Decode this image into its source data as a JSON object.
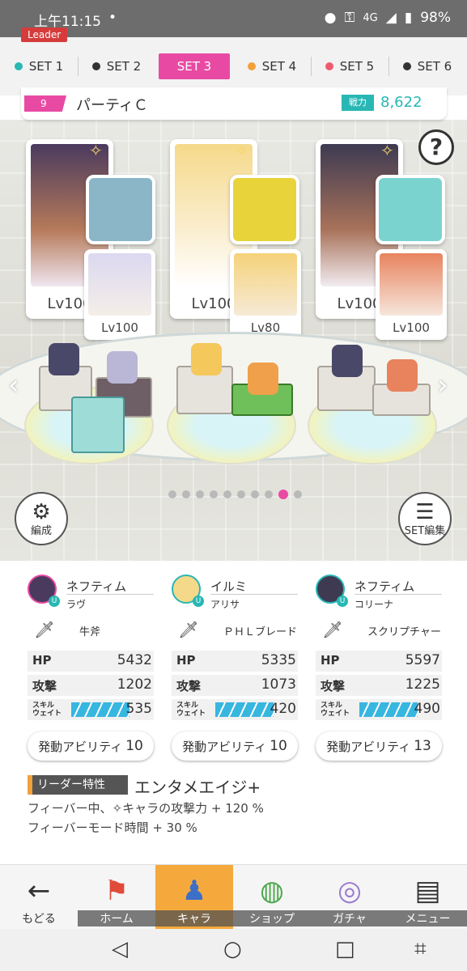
{
  "status": {
    "time": "上午11:15",
    "dot": "•",
    "network": "4G",
    "battery": "98%"
  },
  "tabs": [
    {
      "label": "SET 1",
      "color": "#28b7b4",
      "active": false
    },
    {
      "label": "SET 2",
      "color": "#333333",
      "active": false
    },
    {
      "label": "SET 3",
      "color": "#e84aa3",
      "active": true
    },
    {
      "label": "SET 4",
      "color": "#f2a03c",
      "active": false
    },
    {
      "label": "SET 5",
      "color": "#f05a6e",
      "active": false
    },
    {
      "label": "SET 6",
      "color": "#333333",
      "active": false
    }
  ],
  "party": {
    "number": "9",
    "name": "パーティＣ",
    "power_label": "戦力",
    "power": "8,622"
  },
  "formation": {
    "leader_tag": "Leader",
    "help": "?",
    "members": [
      {
        "main_level": "Lv100",
        "sub_level": "Lv100"
      },
      {
        "main_level": "Lv100",
        "sub_level": "Lv80"
      },
      {
        "main_level": "Lv100",
        "sub_level": "Lv100"
      }
    ],
    "page_dots": 10,
    "page_active": 9,
    "formation_button": "編成",
    "set_edit_button": "SET編集"
  },
  "characters": [
    {
      "name": "ネフティム",
      "sub": "ラヴ",
      "weapon": "牛斧",
      "hp": "5432",
      "atk": "1202",
      "wait": "535",
      "ability_label": "発動アビリティ",
      "ability": "10"
    },
    {
      "name": "イルミ",
      "sub": "アリサ",
      "weapon": "ＰＨＬブレード",
      "hp": "5335",
      "atk": "1073",
      "wait": "420",
      "ability_label": "発動アビリティ",
      "ability": "10"
    },
    {
      "name": "ネフティム",
      "sub": "コリーナ",
      "weapon": "スクリプチャー",
      "hp": "5597",
      "atk": "1225",
      "wait": "490",
      "ability_label": "発動アビリティ",
      "ability": "13"
    }
  ],
  "labels": {
    "hp": "HP",
    "atk": "攻撃",
    "wait": "スキル\nウェイト"
  },
  "leader_trait": {
    "label": "リーダー特性",
    "name": "エンタメエイジ+",
    "desc1": "フィーバー中、✧キャラの攻撃力 + 120 %",
    "desc2": "フィーバーモード時間 + 30 %"
  },
  "nav": {
    "back": "もどる",
    "home": "ホーム",
    "chara": "キャラ",
    "shop": "ショップ",
    "gacha": "ガチャ",
    "menu": "メニュー"
  }
}
